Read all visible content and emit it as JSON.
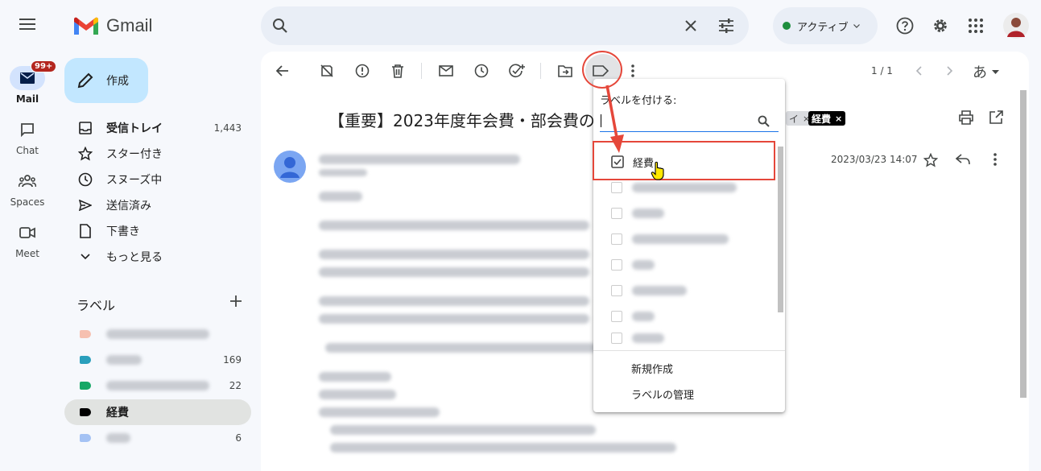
{
  "app": {
    "name": "Gmail"
  },
  "rail": {
    "items": [
      {
        "label": "Mail",
        "badge": "99+"
      },
      {
        "label": "Chat"
      },
      {
        "label": "Spaces"
      },
      {
        "label": "Meet"
      }
    ]
  },
  "header": {
    "status": "アクティブ"
  },
  "sidebar": {
    "compose": "作成",
    "nav": [
      {
        "label": "受信トレイ",
        "count": "1,443"
      },
      {
        "label": "スター付き",
        "count": ""
      },
      {
        "label": "スヌーズ中",
        "count": ""
      },
      {
        "label": "送信済み",
        "count": ""
      },
      {
        "label": "下書き",
        "count": ""
      },
      {
        "label": "もっと見る",
        "count": ""
      }
    ],
    "labels_heading": "ラベル",
    "labels": [
      {
        "label": "",
        "count": "",
        "color": "#f6c0b0"
      },
      {
        "label": "",
        "count": "169",
        "color": "#2a9fbc"
      },
      {
        "label": "",
        "count": "22",
        "color": "#16a765"
      },
      {
        "label": "経費",
        "count": "",
        "color": "#000000"
      },
      {
        "label": "",
        "count": "6",
        "color": "#a4c2f4"
      }
    ]
  },
  "toolbar": {
    "pager": "1 / 1",
    "input_tool": "あ"
  },
  "message": {
    "subject": "【重要】2023年度年会費・部会費の",
    "chip_partial": "イ",
    "chip_label": "経費",
    "date": "2023/03/23 14:07"
  },
  "label_menu": {
    "title": "ラベルを付ける:",
    "checked_item": "経費",
    "new_label": "新規作成",
    "manage_labels": "ラベルの管理"
  },
  "colors": {
    "accent_red": "#e5473a",
    "compose_bg": "#c2e7ff",
    "badge": "#b3261e"
  }
}
